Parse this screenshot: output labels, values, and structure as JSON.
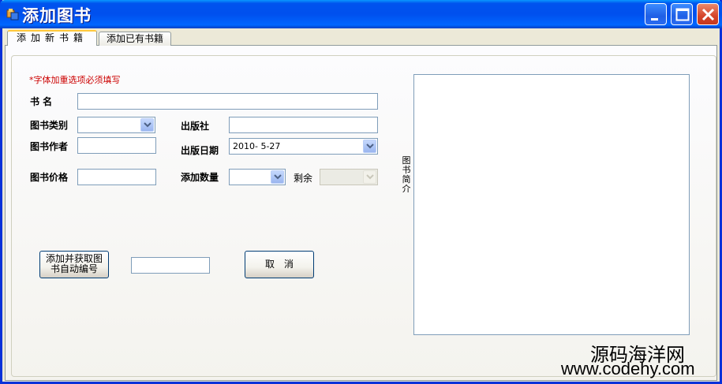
{
  "window": {
    "title": "添加图书",
    "controls": {
      "minimize": "minimize-icon",
      "maximize": "maximize-icon",
      "close": "close-icon"
    }
  },
  "tabs": [
    {
      "label": "添加新书籍",
      "active": true
    },
    {
      "label": "添加已有书籍",
      "active": false
    }
  ],
  "form": {
    "hint": "*字体加重选项必须填写",
    "book_name_label": "书 名",
    "book_name_value": "",
    "category_label": "图书类别",
    "category_value": "",
    "publisher_label": "出版社",
    "publisher_value": "",
    "author_label": "图书作者",
    "author_value": "",
    "pub_date_label": "出版日期",
    "pub_date_value": "2010- 5-27",
    "price_label": "图书价格",
    "price_value": "",
    "add_qty_label": "添加数量",
    "add_qty_value": "",
    "remaining_label": "剩余",
    "remaining_value": "",
    "summary_label": "图书简介",
    "summary_value": ""
  },
  "buttons": {
    "add_line1": "添加并获取图",
    "add_line2": "书自动编号",
    "cancel": "取　消"
  },
  "generated_id_value": "",
  "watermark": {
    "line1": "源码海洋网",
    "line2": "www.codehy.com"
  },
  "colors": {
    "titlebar": "#0054e3",
    "hint": "#cc0000",
    "input_border": "#7f9db9",
    "tab_accent": "#ffc83c"
  }
}
